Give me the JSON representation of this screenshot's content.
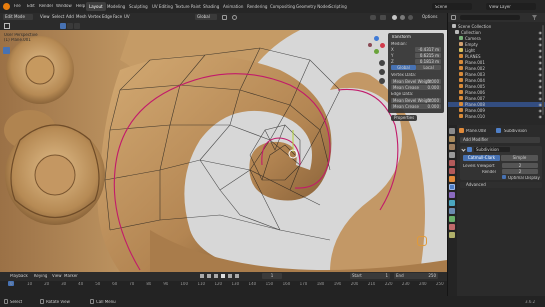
{
  "app": {
    "menus": [
      "File",
      "Edit",
      "Render",
      "Window",
      "Help"
    ],
    "workspaces": [
      "Layout",
      "Modeling",
      "Sculpting",
      "UV Editing",
      "Texture Paint",
      "Shading",
      "Animation",
      "Rendering",
      "Compositing",
      "Geometry Nodes",
      "Scripting"
    ],
    "active_workspace": "Layout",
    "scene": "Scene",
    "view_layer": "View Layer"
  },
  "viewport_header": {
    "mode": "Edit Mode",
    "view": "View",
    "select": "Select",
    "add": "Add",
    "mesh": "Mesh",
    "vertex": "Vertex",
    "edge": "Edge",
    "face": "Face",
    "uv": "UV",
    "transform": "Global",
    "options": "Options"
  },
  "overlay_text": {
    "view_name": "User Perspective",
    "object_name": "(1) Plane.001"
  },
  "npanel": {
    "section1": "Transform",
    "median": "Median:",
    "x": "X",
    "y": "Y",
    "z": "Z",
    "x_val": "-0.4317 m",
    "y_val": "0.6215 m",
    "z_val": "0.1813 m",
    "space": "Global",
    "local": "Local",
    "section2": "Vertex Data:",
    "bevel_weight": "Mean Bevel Weight",
    "crease": "Mean Crease",
    "bw_val": "0.000",
    "cr_val": "0.000",
    "section3": "Edge Data:",
    "edge_bevel": "Mean Bevel Weight",
    "edge_crease": "Mean Crease",
    "eb_val": "0.000",
    "ec_val": "0.000",
    "properties": "Properties"
  },
  "timeline": {
    "playback": "Playback",
    "keying": "Keying",
    "view": "View",
    "marker": "Marker",
    "frame": "1",
    "start_label": "Start",
    "start": "1",
    "end_label": "End",
    "end": "250",
    "ticks": [
      "0",
      "10",
      "20",
      "30",
      "40",
      "50",
      "60",
      "70",
      "80",
      "90",
      "100",
      "110",
      "120",
      "130",
      "140",
      "150",
      "160",
      "170",
      "180",
      "190",
      "200",
      "210",
      "220",
      "230",
      "240",
      "250"
    ]
  },
  "outliner": {
    "title": "Scene Collection",
    "items": [
      {
        "label": "Collection",
        "color": "#b9b9b9"
      },
      {
        "label": "Camera",
        "color": "#7ab37a"
      },
      {
        "label": "Empty",
        "color": "#d0a070"
      },
      {
        "label": "Light",
        "color": "#d8c060"
      },
      {
        "label": "PLANES",
        "color": "#d68a3a"
      },
      {
        "label": "Plane.001",
        "color": "#d68a3a"
      },
      {
        "label": "Plane.002",
        "color": "#d68a3a"
      },
      {
        "label": "Plane.003",
        "color": "#d68a3a"
      },
      {
        "label": "Plane.004",
        "color": "#d68a3a"
      },
      {
        "label": "Plane.005",
        "color": "#d68a3a"
      },
      {
        "label": "Plane.006",
        "color": "#d68a3a"
      },
      {
        "label": "Plane.007",
        "color": "#d68a3a"
      },
      {
        "label": "Plane.008",
        "color": "#d68a3a"
      },
      {
        "label": "Plane.009",
        "color": "#d68a3a"
      },
      {
        "label": "Plane.010",
        "color": "#d68a3a"
      }
    ],
    "selected_index": 12
  },
  "properties": {
    "object": "Plane.008",
    "modifier_tab": "Subdivision",
    "add_modifier": "Add Modifier",
    "modifier_name": "Subdivision",
    "catmull": "Catmull-Clark",
    "simple": "Simple",
    "levels_viewport": "Levels Viewport",
    "render": "Render",
    "levels_val": "2",
    "render_val": "2",
    "optimal": "Optimal Display",
    "advanced": "Advanced"
  },
  "statusbar": {
    "left": "Select",
    "middle": "Rotate View",
    "right": "Call Menu",
    "version": "3.6.2"
  },
  "colors": {
    "gold": "#c9a06a",
    "edge": "#c21a6a",
    "selected_row": "#334d80",
    "accent_blue": "#4772b3"
  }
}
